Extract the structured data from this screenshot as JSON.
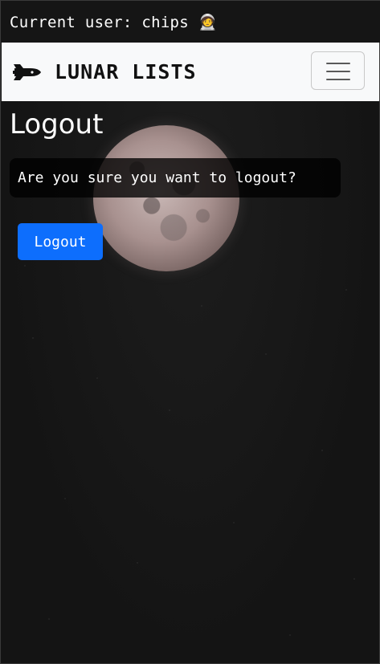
{
  "header": {
    "current_user_text": "Current user: chips 🧑‍🚀"
  },
  "navbar": {
    "brand_icon": "rocket-icon",
    "brand_text": "LUNAR LISTS",
    "toggler_icon": "hamburger-menu-icon"
  },
  "main": {
    "title": "Logout",
    "confirm_message": "Are you sure you want to logout?",
    "logout_button_label": "Logout"
  },
  "colors": {
    "primary_button": "#0d6efd",
    "navbar_bg": "#f8f9fa",
    "page_bg": "#151515"
  }
}
